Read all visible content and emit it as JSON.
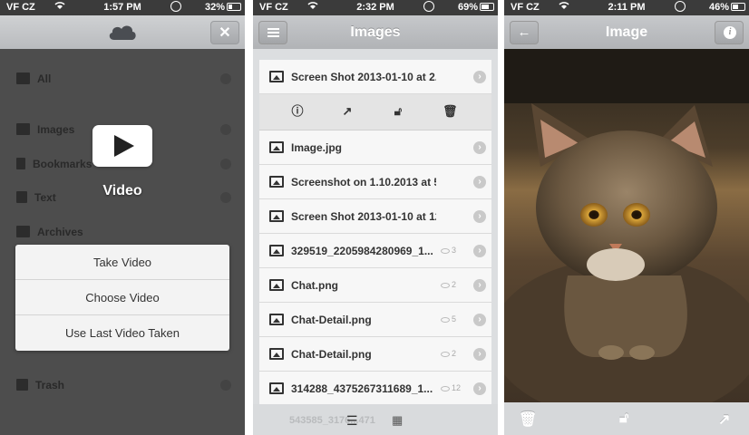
{
  "screens": [
    {
      "status": {
        "carrier": "VF CZ",
        "time": "1:57 PM",
        "battery": "32%",
        "battery_level": 0.32
      },
      "sidebar": {
        "items": [
          {
            "label": "All",
            "icon": "grid-icon"
          },
          {
            "label": "Images",
            "icon": "image-icon"
          },
          {
            "label": "Bookmarks",
            "icon": "bookmark-icon"
          },
          {
            "label": "Text",
            "icon": "text-doc-icon"
          },
          {
            "label": "Archives",
            "icon": "archive-icon"
          },
          {
            "label": "Trash",
            "icon": "trash-icon"
          }
        ]
      },
      "overlay": {
        "badge_label": "Video",
        "sheet": [
          "Take Video",
          "Choose Video",
          "Use Last Video Taken"
        ]
      }
    },
    {
      "status": {
        "carrier": "VF CZ",
        "time": "2:32 PM",
        "battery": "69%",
        "battery_level": 0.69
      },
      "nav": {
        "title": "Images"
      },
      "rows": [
        {
          "name": "Screen Shot 2013-01-10 at 2.2...",
          "views": ""
        },
        {
          "name": "Image.jpg",
          "views": ""
        },
        {
          "name": "Screenshot on 1.10.2013 at 5....",
          "views": ""
        },
        {
          "name": "Screen Shot 2013-01-10 at 12....",
          "views": ""
        },
        {
          "name": "329519_2205984280969_1...",
          "views": "3"
        },
        {
          "name": "Chat.png",
          "views": "2"
        },
        {
          "name": "Chat-Detail.png",
          "views": "5"
        },
        {
          "name": "Chat-Detail.png",
          "views": "2"
        },
        {
          "name": "314288_4375267311689_1...",
          "views": "12"
        }
      ],
      "actions": [
        "info-icon",
        "share-icon",
        "lock-icon",
        "trash-icon"
      ],
      "toolbar": {
        "ghost_text": "543585_3176...471"
      }
    },
    {
      "status": {
        "carrier": "VF CZ",
        "time": "2:11 PM",
        "battery": "46%",
        "battery_level": 0.46
      },
      "nav": {
        "title": "Image"
      },
      "toolbar": [
        "trash-icon",
        "lock-icon",
        "share-icon"
      ]
    }
  ]
}
